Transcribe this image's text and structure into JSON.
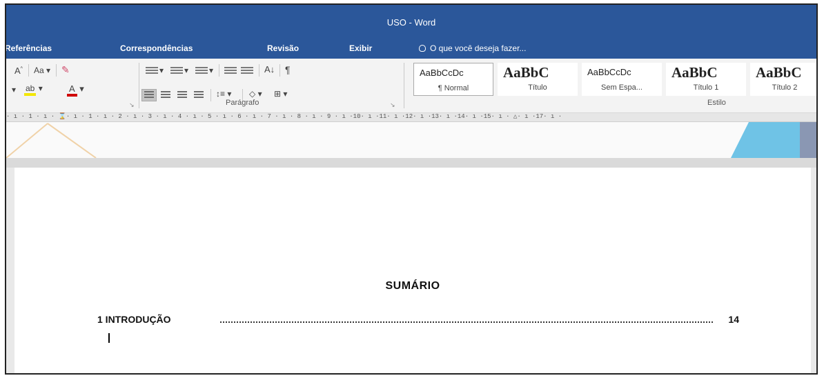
{
  "window": {
    "title": "USO - Word"
  },
  "tabs": [
    {
      "label": "Referências"
    },
    {
      "label": "Correspondências"
    },
    {
      "label": "Revisão"
    },
    {
      "label": "Exibir"
    }
  ],
  "tell_me": {
    "text": "O que você deseja fazer..."
  },
  "ribbon": {
    "font_size_case": "Aa",
    "paragraph_group_label": "Parágrafo",
    "style_group_label": "Estilo",
    "styles": [
      {
        "sample": "AaBbCcDc",
        "name": "¶ Normal",
        "selected": true
      },
      {
        "sample": "AaBbC",
        "name": "Título",
        "selected": false
      },
      {
        "sample": "AaBbCcDc",
        "name": "Sem Espa...",
        "selected": false
      },
      {
        "sample": "AaBbC",
        "name": "Título 1",
        "selected": false
      },
      {
        "sample": "AaBbC",
        "name": "Título 2",
        "selected": false
      }
    ]
  },
  "ruler": {
    "text": "· ı · 1 · ı · ⌛· ı · 1 · ı · 2 · ı · 3 · ı · 4 · ı · 5 · ı · 6 · ı · 7 · ı · 8 · ı · 9 · ı ·10· ı ·11· ı ·12· ı ·13· ı ·14· ı ·15· ı · △· ı ·17· ı ·"
  },
  "document": {
    "summary_title": "SUMÁRIO",
    "toc": [
      {
        "label": "1 INTRODUÇÃO",
        "page": "14"
      }
    ]
  },
  "colors": {
    "titlebar": "#2b579a",
    "ribbon": "#f3f3f3"
  }
}
